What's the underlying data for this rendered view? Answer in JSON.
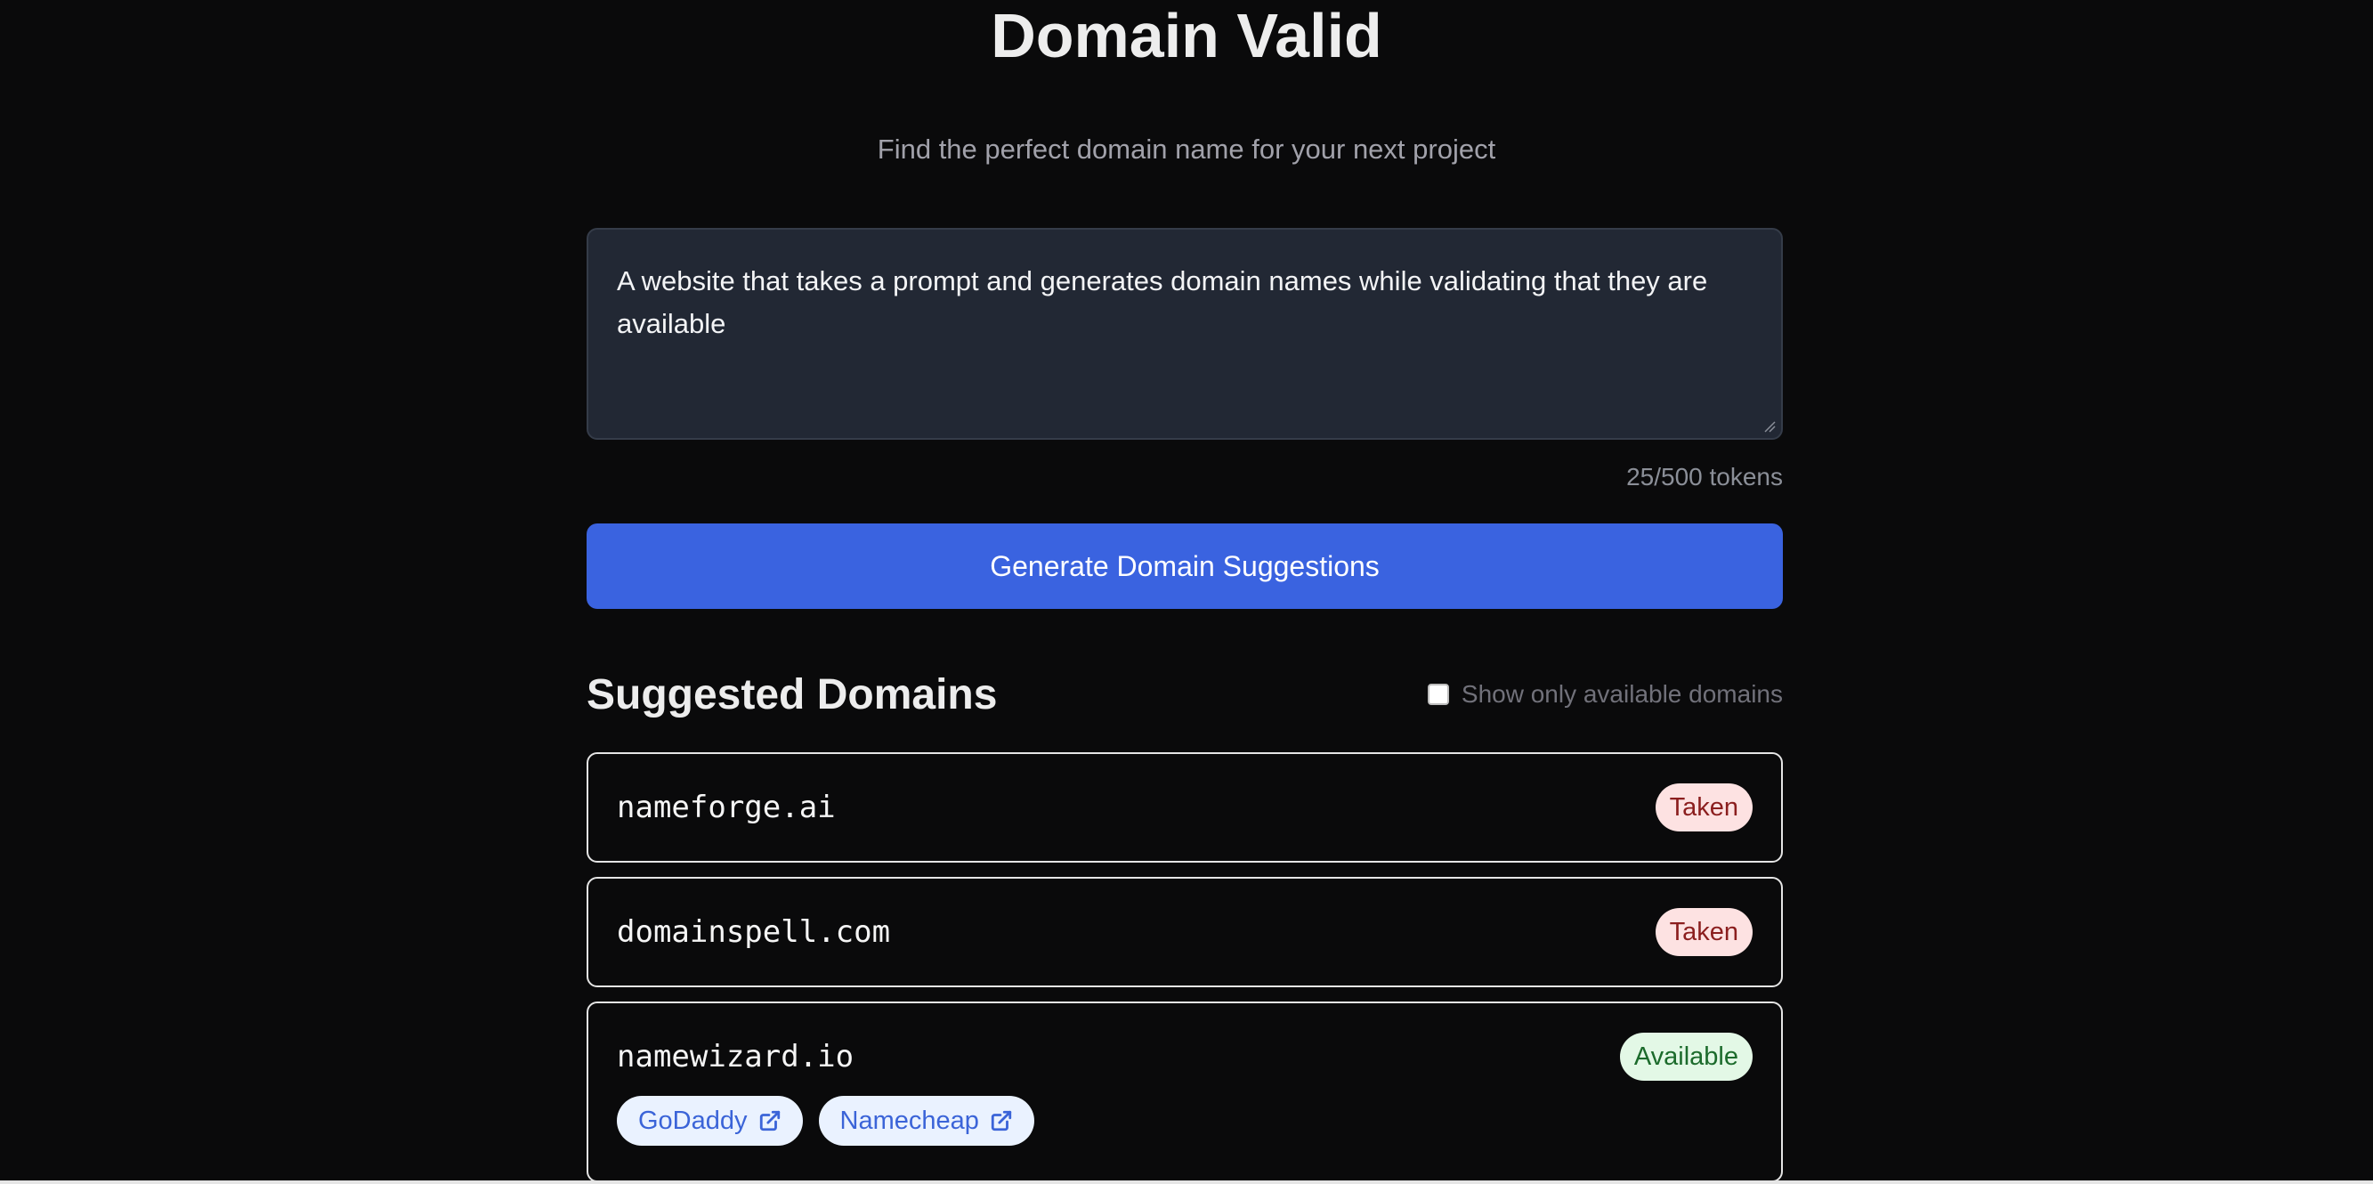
{
  "header": {
    "title": "Domain Valid",
    "subtitle": "Find the perfect domain name for your next project"
  },
  "prompt": {
    "value": "A website that takes a prompt and generates domain names while validating that they are available",
    "token_count": "25/500 tokens"
  },
  "generate_button": {
    "label": "Generate Domain Suggestions"
  },
  "results": {
    "title": "Suggested Domains",
    "filter_label": "Show only available domains",
    "filter_checked": false,
    "domains": [
      {
        "name": "nameforge.ai",
        "status": "Taken"
      },
      {
        "name": "domainspell.com",
        "status": "Taken"
      },
      {
        "name": "namewizard.io",
        "status": "Available",
        "registrars": [
          {
            "label": "GoDaddy",
            "icon": "external-link-icon"
          },
          {
            "label": "Namecheap",
            "icon": "external-link-icon"
          }
        ]
      }
    ]
  },
  "colors": {
    "background": "#0a0a0b",
    "primary": "#3a63e0",
    "taken_bg": "#fde2e2",
    "taken_text": "#8b1e1e",
    "available_bg": "#e3f8e6",
    "available_text": "#1c6b2c",
    "registrar_bg": "#eaf2ff",
    "registrar_text": "#3b64d8"
  }
}
